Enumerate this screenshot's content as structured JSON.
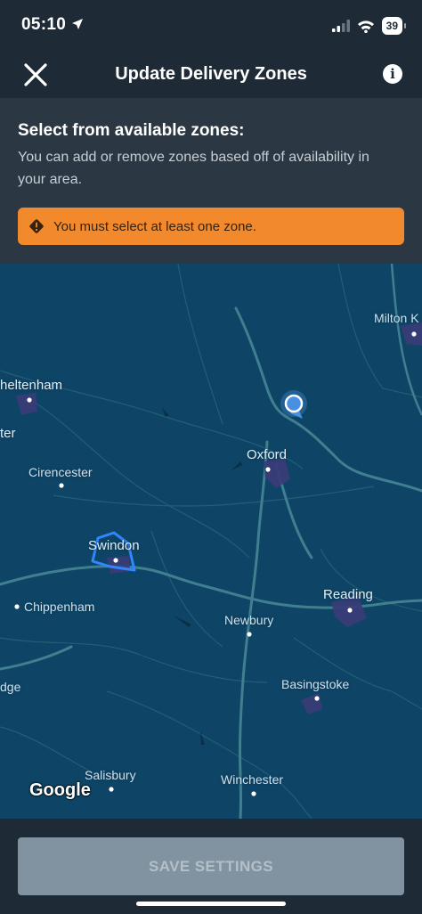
{
  "status_bar": {
    "time": "05:10",
    "battery": "39",
    "icons": [
      "location-arrow-icon",
      "cellular-signal-icon",
      "wifi-icon",
      "battery-icon"
    ]
  },
  "nav": {
    "title": "Update Delivery Zones",
    "close_icon": "close-icon",
    "info_icon": "info-icon",
    "info_glyph": "i"
  },
  "panel": {
    "heading": "Select from available zones:",
    "description": "You can add or remove zones based off of availability in your area.",
    "warning": {
      "text": "You must select at least one zone.",
      "icon": "warning-icon",
      "color": "#f2892c"
    }
  },
  "map": {
    "watermark": "Google",
    "places": [
      {
        "key": "milton",
        "name": "Milton K"
      },
      {
        "key": "cheltenham",
        "name": "heltenham"
      },
      {
        "key": "ter",
        "name": "ter"
      },
      {
        "key": "cirencester",
        "name": "Cirencester"
      },
      {
        "key": "oxford",
        "name": "Oxford"
      },
      {
        "key": "swindon",
        "name": "Swindon"
      },
      {
        "key": "chippenham",
        "name": "Chippenham"
      },
      {
        "key": "reading",
        "name": "Reading"
      },
      {
        "key": "newbury",
        "name": "Newbury"
      },
      {
        "key": "dge",
        "name": "dge"
      },
      {
        "key": "basingstoke",
        "name": "Basingstoke"
      },
      {
        "key": "salisbury",
        "name": "Salisbury"
      },
      {
        "key": "winchester",
        "name": "Winchester"
      }
    ],
    "colors": {
      "background": "#0e4566",
      "roads": "#3f7f8f",
      "zone_outline": "#2f86ff",
      "location_marker": "#4a90e2"
    }
  },
  "footer": {
    "save_label": "SAVE SETTINGS"
  }
}
